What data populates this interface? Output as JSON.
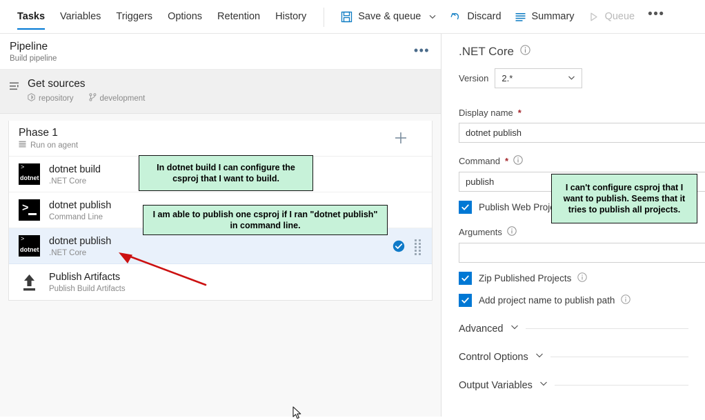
{
  "topbar": {
    "tabs": [
      {
        "label": "Tasks",
        "active": true
      },
      {
        "label": "Variables",
        "active": false
      },
      {
        "label": "Triggers",
        "active": false
      },
      {
        "label": "Options",
        "active": false
      },
      {
        "label": "Retention",
        "active": false
      },
      {
        "label": "History",
        "active": false
      }
    ],
    "toolbar": [
      {
        "label": "Save & queue",
        "icon": "save-icon",
        "disabled": false,
        "has_chevron": true
      },
      {
        "label": "Discard",
        "icon": "undo-icon",
        "disabled": false,
        "has_chevron": false
      },
      {
        "label": "Summary",
        "icon": "list-icon",
        "disabled": false,
        "has_chevron": false
      },
      {
        "label": "Queue",
        "icon": "play-icon",
        "disabled": true,
        "has_chevron": false
      }
    ],
    "overflow_label": "•••"
  },
  "left_pane": {
    "pipeline": {
      "title": "Pipeline",
      "subtitle": "Build pipeline",
      "overflow_label": "•••"
    },
    "get_sources": {
      "title": "Get sources",
      "repository": "repository",
      "branch": "development"
    },
    "phase": {
      "title": "Phase 1",
      "subtitle": "Run on agent"
    },
    "tasks": [
      {
        "name": "dotnet build",
        "sub": ".NET Core",
        "icon": "dotnet-icon",
        "selected": false,
        "checked": false
      },
      {
        "name": "dotnet publish",
        "sub": "Command Line",
        "icon": "command-line-icon",
        "selected": false,
        "checked": false
      },
      {
        "name": "dotnet publish",
        "sub": ".NET Core",
        "icon": "dotnet-icon",
        "selected": true,
        "checked": true
      },
      {
        "name": "Publish Artifacts",
        "sub": "Publish Build Artifacts",
        "icon": "upload-icon",
        "selected": false,
        "checked": false
      }
    ]
  },
  "right_pane": {
    "title": ".NET Core",
    "version": {
      "label": "Version",
      "value": "2.*"
    },
    "display_name": {
      "label": "Display name",
      "required": "*",
      "value": "dotnet publish"
    },
    "command": {
      "label": "Command",
      "required": "*",
      "value": "publish"
    },
    "publish_web_projects": {
      "label": "Publish Web Projects",
      "checked": true
    },
    "arguments": {
      "label": "Arguments",
      "value": "",
      "placeholder": ""
    },
    "zip_published_projects": {
      "label": "Zip Published Projects",
      "checked": true
    },
    "add_project_name": {
      "label": "Add project name to publish path",
      "checked": true
    },
    "sections": [
      {
        "label": "Advanced"
      },
      {
        "label": "Control Options"
      },
      {
        "label": "Output Variables"
      }
    ]
  },
  "annotations": [
    {
      "id": "annot-1",
      "text": "In dotnet build I can configure the csproj that I want to build."
    },
    {
      "id": "annot-2",
      "text": "I am able to publish one csproj if I ran \"dotnet publish\" in command line."
    },
    {
      "id": "annot-3",
      "text": "I can't configure csproj that I want to publish. Seems that it tries to publish all projects."
    }
  ],
  "colors": {
    "accent": "#0078d4",
    "annotation_bg": "#c7f2d9",
    "selected_row": "#e9f1fb",
    "arrow": "#cc1111"
  }
}
